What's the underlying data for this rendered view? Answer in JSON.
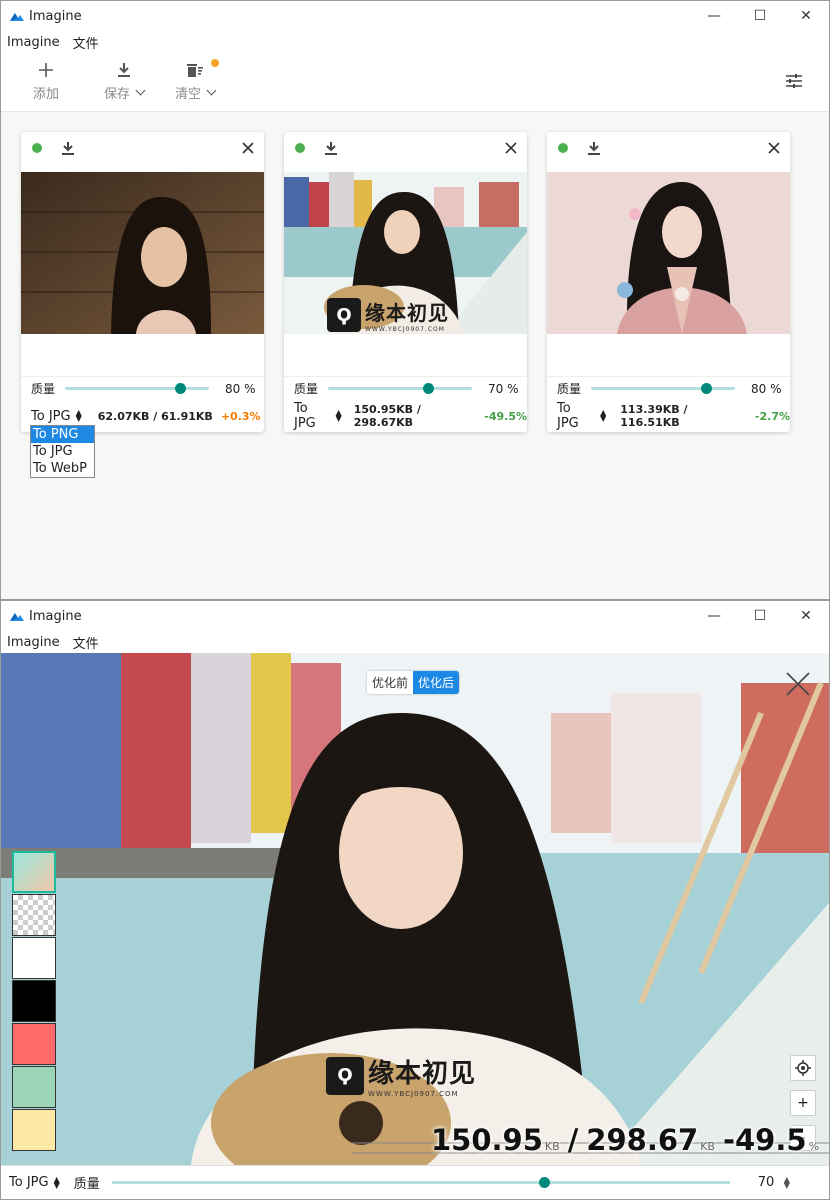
{
  "app_title": "Imagine",
  "menu": [
    "Imagine",
    "文件"
  ],
  "window_controls": {
    "minimize": "—",
    "maximize": "☐",
    "close": "✕"
  },
  "toolbar": {
    "add_label": "添加",
    "save_label": "保存",
    "clear_label": "清空",
    "add_icon": "plus-icon",
    "save_icon": "download-icon",
    "clear_icon": "trash-icon",
    "settings_icon": "sliders-icon",
    "badge_color": "#f5a623"
  },
  "cards": [
    {
      "status_color": "#4caf50",
      "quality_label": "质量",
      "quality": 80,
      "quality_text": "80 %",
      "format": "To JPG",
      "sizes": "62.07KB / 61.91KB",
      "change": "+0.3%",
      "change_color": "#f57c00"
    },
    {
      "status_color": "#4caf50",
      "quality_label": "质量",
      "quality": 70,
      "quality_text": "70 %",
      "format": "To JPG",
      "sizes": "150.95KB / 298.67KB",
      "change": "-49.5%",
      "change_color": "#43a047"
    },
    {
      "status_color": "#4caf50",
      "quality_label": "质量",
      "quality": 80,
      "quality_text": "80 %",
      "format": "To JPG",
      "sizes": "113.39KB / 116.51KB",
      "change": "-2.7%",
      "change_color": "#43a047"
    }
  ],
  "format_dropdown": {
    "options": [
      "To PNG",
      "To JPG",
      "To WebP"
    ],
    "highlighted": "To PNG"
  },
  "watermark": {
    "text": "缘本初见",
    "url": "WWW.YBCJ0907.COM"
  },
  "viewer": {
    "toggle_before": "优化前",
    "toggle_after": "优化后",
    "active_toggle": "优化后",
    "swatches": [
      "#a8e0d8",
      "checker",
      "#ffffff",
      "#000000",
      "#ff6b6b",
      "#9bd5b8",
      "#fde9a7"
    ],
    "zoom_buttons": [
      "+",
      "-"
    ],
    "locate_icon": "crosshair-icon",
    "stats": {
      "new_size": "150.95",
      "old_size": "298.67",
      "unit": "KB",
      "change": "-49.5",
      "pct_unit": "%"
    }
  },
  "bottom_bar": {
    "format": "To JPG",
    "quality_label": "质量",
    "quality": 70,
    "quality_text": "70"
  },
  "colors": {
    "accent": "#1e88e5",
    "slider_track": "#b2dfdb",
    "slider_knob": "#00897b"
  }
}
